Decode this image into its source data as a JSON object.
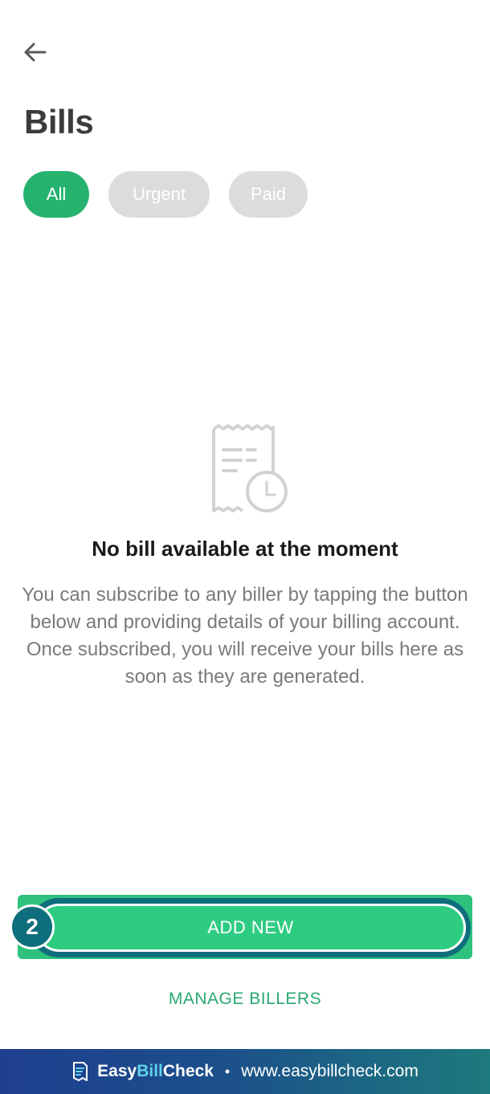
{
  "header": {
    "title": "Bills"
  },
  "filters": [
    {
      "label": "All",
      "active": true
    },
    {
      "label": "Urgent",
      "active": false
    },
    {
      "label": "Paid",
      "active": false
    }
  ],
  "empty_state": {
    "icon": "receipt-clock-icon",
    "title": "No bill available at the moment",
    "description": "You can subscribe to any biller by tapping the button below and providing details of your billing account. Once subscribed, you will receive your bills here as soon as they are generated."
  },
  "actions": {
    "add_new_label": "ADD NEW",
    "manage_billers_label": "MANAGE BILLERS",
    "step_number": "2"
  },
  "footer": {
    "brand_easy": "Easy",
    "brand_bill": "Bill",
    "brand_check": "Check",
    "separator": "•",
    "url": "www.easybillcheck.com"
  },
  "colors": {
    "accent_green": "#26b36f",
    "chip_inactive": "#dcdcdc",
    "step_teal": "#0f6e7c",
    "footer_blue": "#1e3f8f"
  }
}
